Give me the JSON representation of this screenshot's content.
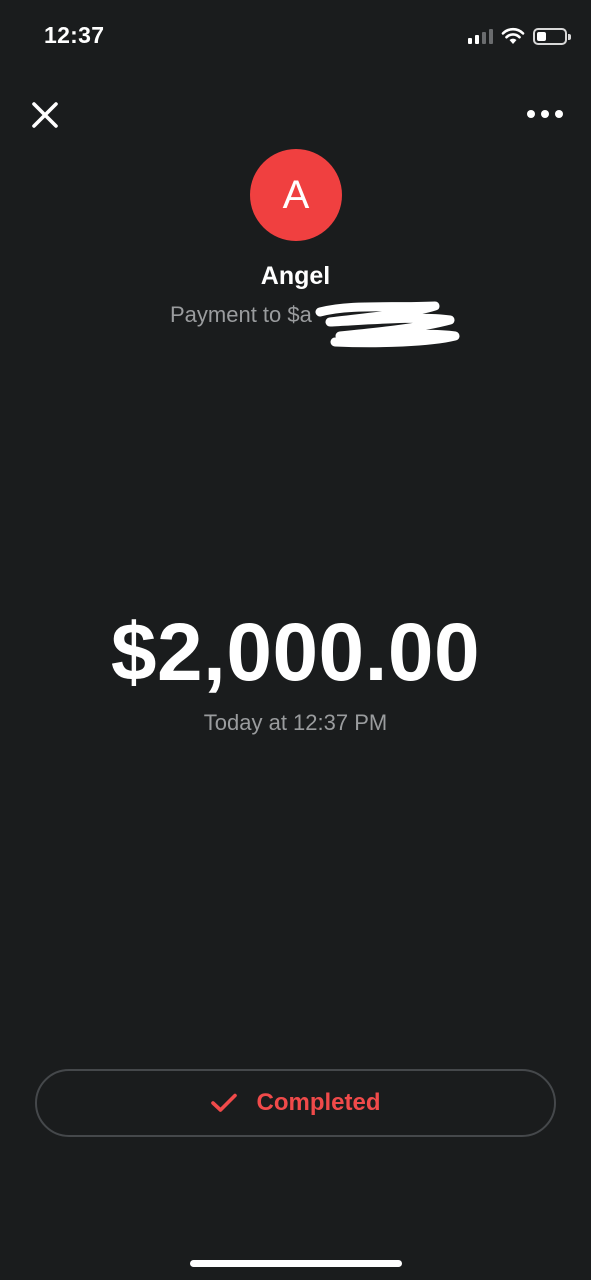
{
  "status_bar": {
    "time": "12:37",
    "icons": [
      "signal-icon",
      "wifi-icon",
      "battery-icon"
    ]
  },
  "nav": {
    "close_icon": "close-icon",
    "more_icon": "more-options-icon"
  },
  "recipient": {
    "avatar_initial": "A",
    "avatar_color": "#f04040",
    "name": "Angel",
    "subtitle": "Payment to $a"
  },
  "payment": {
    "amount": "$2,000.00",
    "timestamp": "Today at 12:37 PM"
  },
  "status": {
    "label": "Completed",
    "icon": "checkmark-icon",
    "color": "#f04a4a"
  },
  "colors": {
    "background": "#1a1c1d",
    "text_primary": "#ffffff",
    "text_secondary": "#9a9c9e"
  }
}
